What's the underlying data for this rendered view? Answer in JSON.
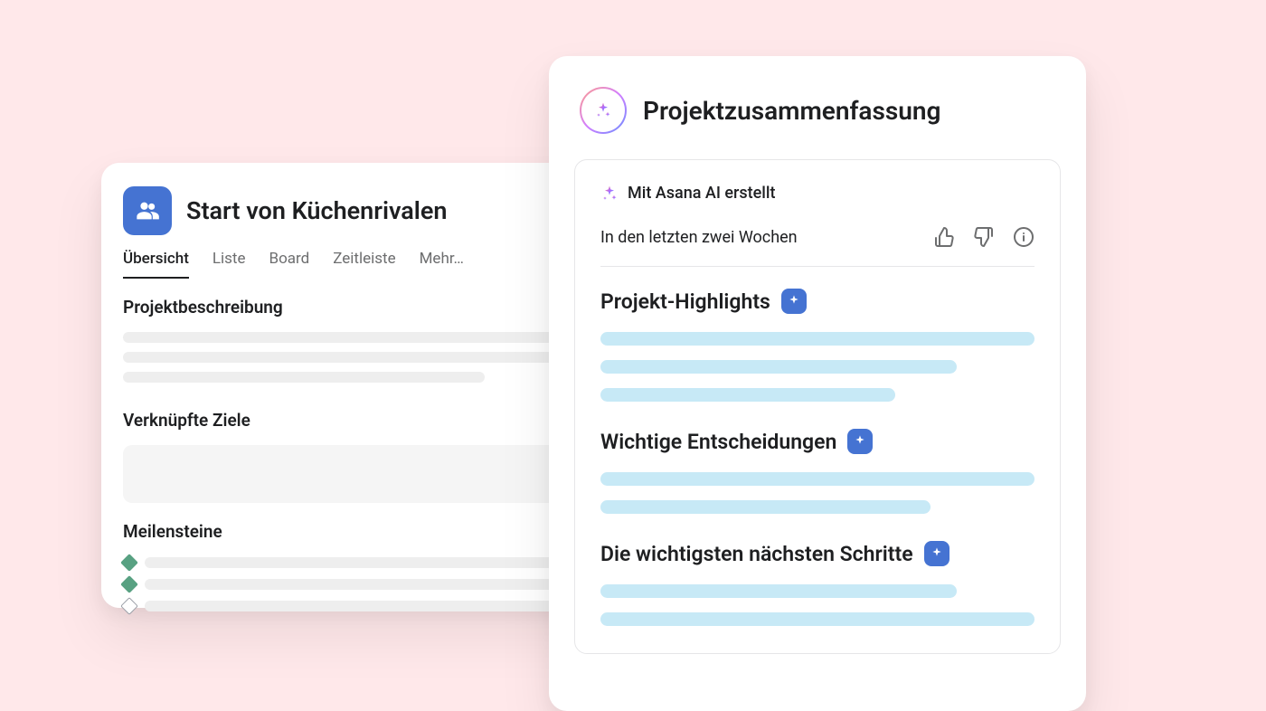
{
  "left": {
    "title": "Start von Küchenrivalen",
    "tabs": [
      "Übersicht",
      "Liste",
      "Board",
      "Zeitleiste",
      "Mehr…"
    ],
    "activeTab": 0,
    "sections": {
      "description": "Projektbeschreibung",
      "goals": "Verknüpfte Ziele",
      "milestones": "Meilensteine"
    },
    "milestones": [
      {
        "done": true
      },
      {
        "done": true
      },
      {
        "done": false
      }
    ]
  },
  "right": {
    "title": "Projektzusammenfassung",
    "ai_label": "Mit Asana AI erstellt",
    "period": "In den letzten zwei Wochen",
    "sections": [
      "Projekt-Highlights",
      "Wichtige Entscheidungen",
      "Die wichtigsten nächsten Schritte"
    ]
  }
}
